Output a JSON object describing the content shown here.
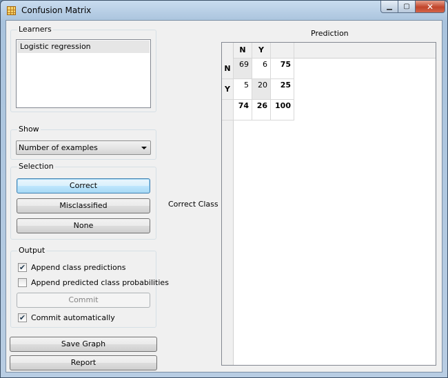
{
  "window": {
    "title": "Confusion Matrix",
    "minimize": "▁",
    "maximize": "▢",
    "close": "✕"
  },
  "learners": {
    "title": "Learners",
    "items": [
      "Logistic regression"
    ]
  },
  "show": {
    "title": "Show",
    "selected": "Number of examples"
  },
  "selection": {
    "title": "Selection",
    "correct": "Correct",
    "misclassified": "Misclassified",
    "none": "None"
  },
  "output": {
    "title": "Output",
    "append_predictions": {
      "label": "Append class predictions",
      "checked": true
    },
    "append_probabilities": {
      "label": "Append predicted class probabilities",
      "checked": false
    },
    "commit": "Commit",
    "commit_auto": {
      "label": "Commit automatically",
      "checked": true
    }
  },
  "buttons": {
    "save_graph": "Save Graph",
    "report": "Report"
  },
  "matrix": {
    "prediction_label": "Prediction",
    "correct_class_label": "Correct Class",
    "col_headers": [
      "N",
      "Y"
    ],
    "row_headers": [
      "N",
      "Y"
    ],
    "rows": [
      [
        "69",
        "6",
        "75"
      ],
      [
        "5",
        "20",
        "25"
      ]
    ],
    "totals": [
      "74",
      "26",
      "100"
    ]
  },
  "colors": {
    "accent": "#3c7fb1",
    "title_gradient": "#a9c3dd"
  }
}
